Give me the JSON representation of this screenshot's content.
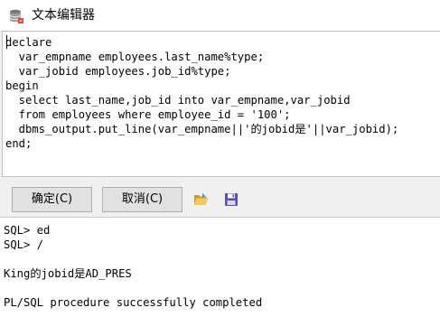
{
  "window": {
    "title": "文本编辑器",
    "icon": "database-icon"
  },
  "editor": {
    "lines": [
      "declare",
      "  var_empname employees.last_name%type;",
      "  var_jobid employees.job_id%type;",
      "begin",
      "  select last_name,job_id into var_empname,var_jobid",
      "  from employees where employee_id = '100';",
      "  dbms_output.put_line(var_empname||'的jobid是'||var_jobid);",
      "end;"
    ]
  },
  "buttons": {
    "ok_label": "确定(C)",
    "cancel_label": "取消(C)"
  },
  "toolbar": {
    "open_icon": "folder-open-icon",
    "save_icon": "save-icon"
  },
  "console": {
    "lines": [
      "SQL> ed",
      "SQL> /",
      "",
      "King的jobid是AD_PRES",
      "",
      "PL/SQL procedure successfully completed"
    ]
  },
  "colors": {
    "title_bar": "#ffffff",
    "window_bg": "#f0f0f0",
    "button_bg": "#e1e1e1",
    "folder_icon": "#e8b84a",
    "save_icon": "#5b4bb7"
  }
}
